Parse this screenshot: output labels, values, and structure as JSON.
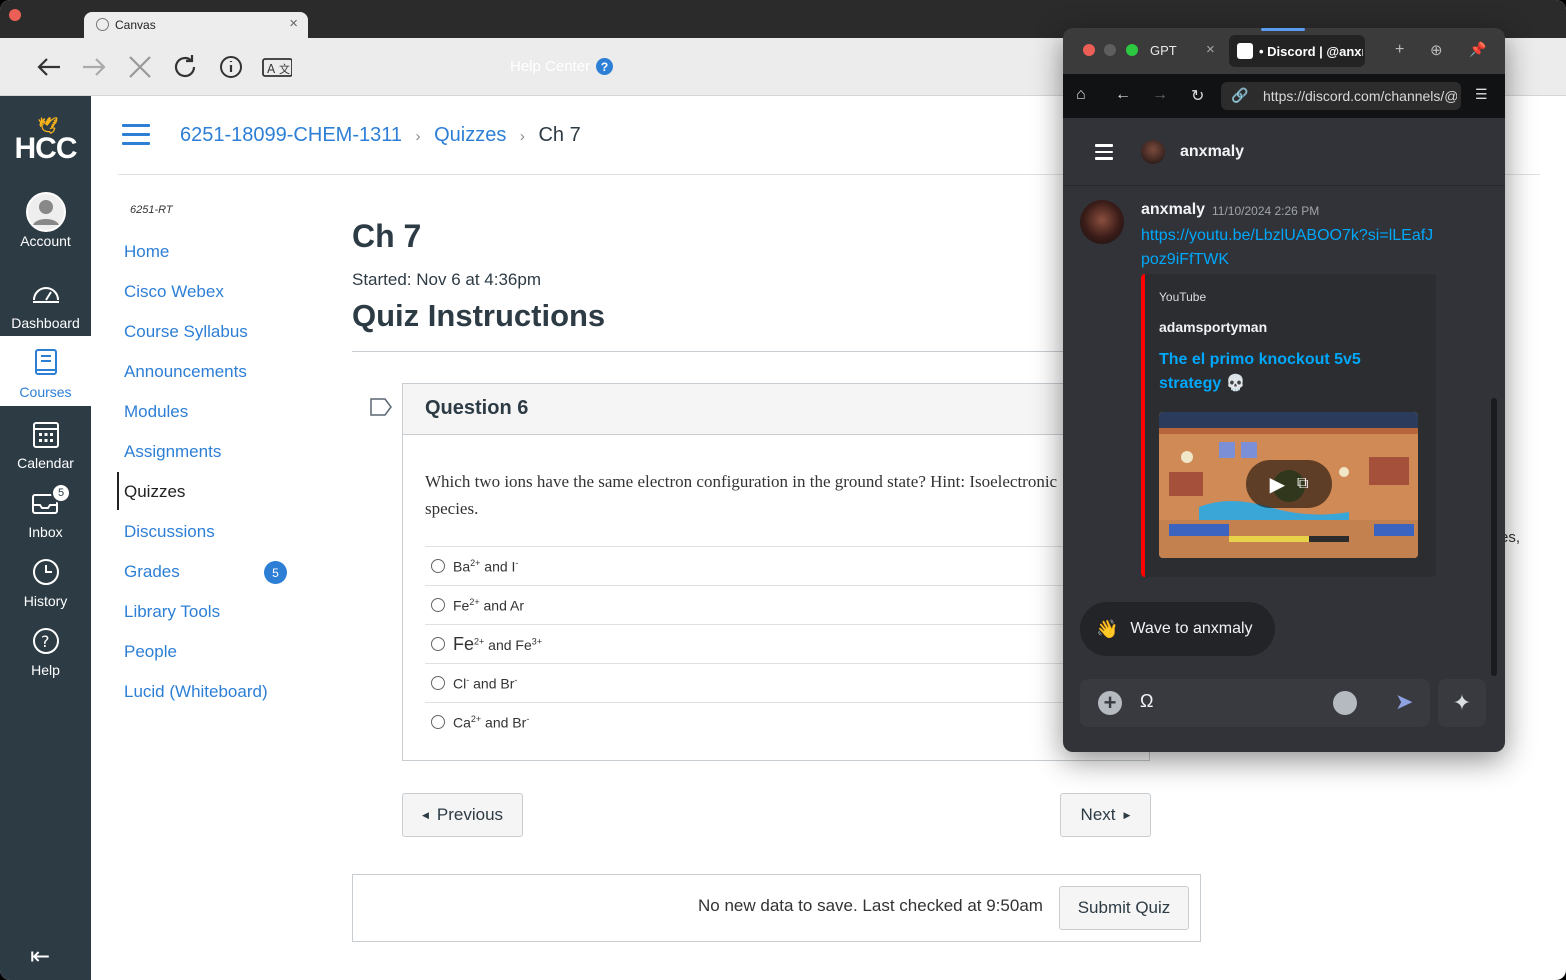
{
  "browser": {
    "tab_title": "Canvas",
    "tab_close": "×",
    "help_center": "Help Center"
  },
  "global_nav": {
    "logo": "HCC",
    "items": [
      {
        "label": "Account"
      },
      {
        "label": "Dashboard"
      },
      {
        "label": "Courses"
      },
      {
        "label": "Calendar"
      },
      {
        "label": "Inbox",
        "badge": "5"
      },
      {
        "label": "History"
      },
      {
        "label": "Help"
      }
    ]
  },
  "breadcrumb": {
    "course": "6251-18099-CHEM-1311",
    "section": "Quizzes",
    "current": "Ch 7",
    "sep": "›"
  },
  "course_nav": {
    "code": "6251-RT",
    "items": [
      {
        "label": "Home"
      },
      {
        "label": "Cisco Webex"
      },
      {
        "label": "Course Syllabus"
      },
      {
        "label": "Announcements"
      },
      {
        "label": "Modules"
      },
      {
        "label": "Assignments"
      },
      {
        "label": "Quizzes"
      },
      {
        "label": "Discussions"
      },
      {
        "label": "Grades",
        "badge": "5"
      },
      {
        "label": "Library Tools"
      },
      {
        "label": "People"
      },
      {
        "label": "Lucid (Whiteboard)"
      }
    ]
  },
  "quiz": {
    "title": "Ch 7",
    "started": "Started: Nov 6 at 4:36pm",
    "instructions_heading": "Quiz Instructions",
    "question_label": "Question 6",
    "question_line1": "Which two ions have the same electron configuration in the ground state? Hint: Isoelectronic",
    "question_line2": "species.",
    "answers": [
      {
        "a": "Ba",
        "a_sup": "2+",
        "mid": " and I",
        "b_sup": "-"
      },
      {
        "a": "Fe",
        "a_sup": "2+",
        "mid": " and Ar",
        "b_sup": ""
      },
      {
        "a": "Fe",
        "a_sup": "2+",
        "mid": " and Fe",
        "b_sup": "3+"
      },
      {
        "a": "Cl",
        "a_sup": "-",
        "mid": " and Br",
        "b_sup": "-"
      },
      {
        "a": "Ca",
        "a_sup": "2+",
        "mid": " and Br",
        "b_sup": "-"
      }
    ],
    "prev_label": "Previous",
    "next_label": "Next",
    "save_status": "No new data to save. Last checked at 9:50am",
    "submit_label": "Submit Quiz",
    "side_fragment": "es,"
  },
  "discord": {
    "tab_gpt": "GPT",
    "tab_close": "×",
    "tab_discord": "• Discord | @anxmaly",
    "url": "https://discord.com/channels/@me",
    "header_name": "anxmaly",
    "message": {
      "author": "anxmaly",
      "time": "11/10/2024 2:26 PM",
      "link": "https://youtu.be/LbzlUABOO7k?si=lLEafJpoz9iFfTWK"
    },
    "embed": {
      "source": "YouTube",
      "author": "adamsportyman",
      "title": "The el primo knockout 5v5 strategy",
      "skull": "💀"
    },
    "wave_label": "Wave to anxmaly",
    "input_value": "Ω",
    "accent_color": "#00a8fc",
    "embed_bar_color": "#ff0000"
  }
}
